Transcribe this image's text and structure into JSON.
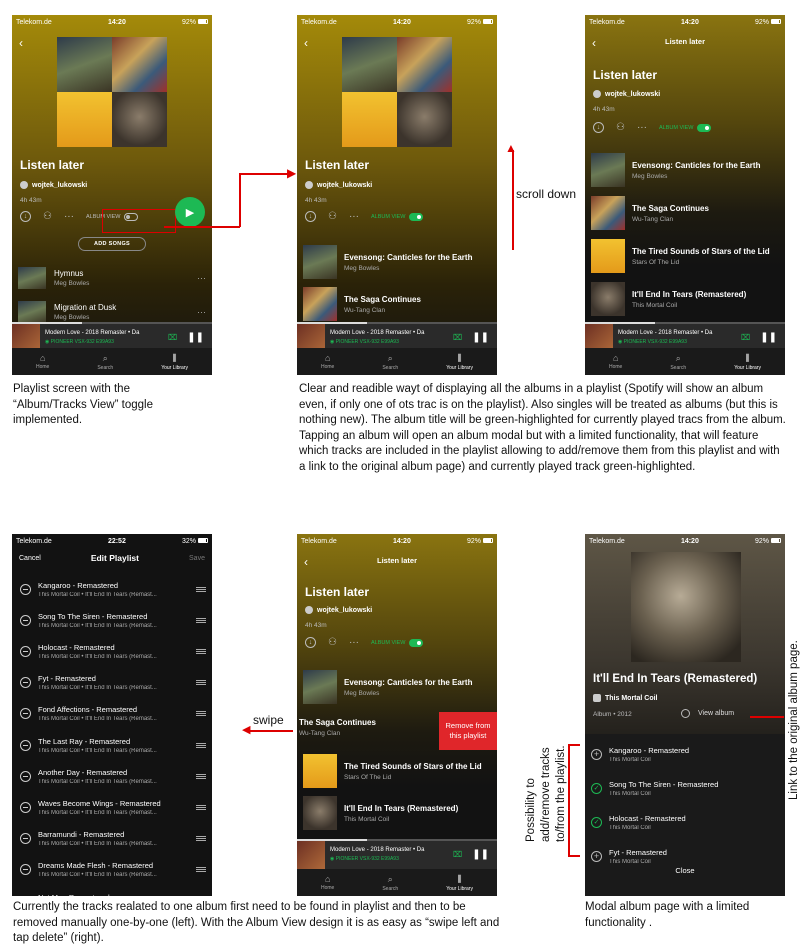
{
  "status": {
    "carrier": "Telekom.de",
    "time": "14:20",
    "battery": "92%",
    "time_alt": "22:52",
    "battery_alt": "32%"
  },
  "playlist": {
    "title": "Listen later",
    "owner": "wojtek_lukowski",
    "duration": "4h 43m",
    "album_view": "ALBUM VIEW",
    "add_songs": "ADD SONGS",
    "header": "Listen later"
  },
  "tracks": [
    {
      "title": "Hymnus",
      "artist": "Meg Bowles"
    },
    {
      "title": "Migration at Dusk",
      "artist": "Meg Bowles"
    }
  ],
  "albums": [
    {
      "title": "Evensong: Canticles for the Earth",
      "artist": "Meg Bowles"
    },
    {
      "title": "The Saga Continues",
      "artist": "Wu-Tang Clan"
    },
    {
      "title": "The Tired Sounds of Stars of the Lid",
      "artist": "Stars Of The Lid"
    },
    {
      "title": "It'll End In Tears (Remastered)",
      "artist": "This Mortal Coil"
    }
  ],
  "mini_player": {
    "track": "Modern Love - 2018 Remaster • Da",
    "device": "PIONEER VSX-932 E99A93"
  },
  "tabs": {
    "home": "Home",
    "search": "Search",
    "library": "Your Library"
  },
  "edit": {
    "cancel": "Cancel",
    "title": "Edit Playlist",
    "save": "Save",
    "sub": "This Mortal Coil • It'll End In Tears (Remast...",
    "rows": [
      "Kangaroo - Remastered",
      "Song To The Siren - Remastered",
      "Holocast - Remastered",
      "Fyt - Remastered",
      "Fond Affections - Remastered",
      "The Last Ray - Remastered",
      "Another Day - Remastered",
      "Waves Become Wings - Remastered",
      "Barramundi - Remastered",
      "Dreams Made Flesh - Remastered",
      "Not Me - Remastered"
    ]
  },
  "swipe": {
    "remove": "Remove from this playlist",
    "label": "swipe"
  },
  "modal": {
    "title": "It'll End In Tears (Remastered)",
    "artist": "This Mortal Coil",
    "meta": "Album • 2012",
    "view": "View album",
    "close": "Close",
    "tracks": [
      {
        "title": "Kangaroo - Remastered",
        "state": "add"
      },
      {
        "title": "Song To The Siren - Remastered",
        "state": "added"
      },
      {
        "title": "Holocast - Remastered",
        "state": "added"
      },
      {
        "title": "Fyt - Remastered",
        "state": "add"
      }
    ],
    "artist_line": "This Mortal Coil"
  },
  "annotations": {
    "scroll": "scroll down",
    "cap1": "Playlist screen with the “Album/Tracks View” toggle implemented.",
    "cap2": "Clear and readible wayt of displaying all the albums in a playlist (Spotify will show an album even, if only one of ots trac is on the playlist). Also singles will be treated as albums (but this is nothing new). The album title will be green-highlighted for currently played tracs from the album.",
    "cap2b": "Tapping an album will open an album modal but with a limited functionality, that will feature which tracks are included in the playlist allowing to add/remove them from this playlist and with a link to the original album page) and currently played track green-highlighted.",
    "cap3": "Currently the tracks realated to one album first need to be found in playlist and then to be removed manually one-by-one (left). With the Album View design it is  as easy as “swipe left and tap delete” (right).",
    "cap4": "Modal album page with a limited functionality .",
    "side1": "Possibility to add/remove tracks to/from the playlist.",
    "side2": "Link to the original album page."
  }
}
